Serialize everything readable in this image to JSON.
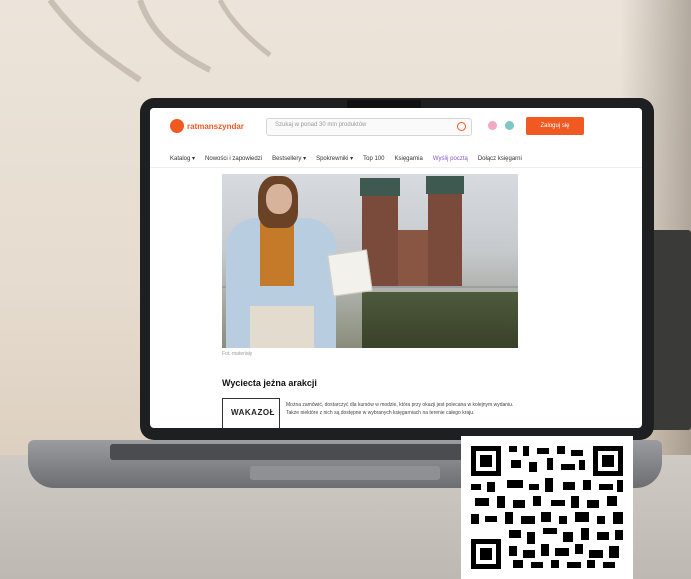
{
  "site": {
    "logo_text": "ratmanszyndar",
    "search_placeholder": "Szukaj w ponad 30 mln produktów",
    "cta_label": "Zaloguj się",
    "accent": "#f05a22"
  },
  "nav": {
    "items": [
      "Katalog ▾",
      "Nowości i zapowiedzi",
      "Bestsellery ▾",
      "Spokrewniki ▾",
      "Top 100",
      "Księgarnia",
      "Wyślij pocztą",
      "Dołącz księgarni"
    ]
  },
  "article": {
    "photo_caption": "Fot. materiały",
    "heading": "Wyciecta jeżna arakcji",
    "stamp_text": "WAKAZOŁ",
    "paragraph": "Można zamówić, dostarczyć dla kursów w modzie, która przy okazji jest polecana w kolejnym wydaniu. Także niektóre z nich są dostępne w wybranych księgarniach na terenie całego kraju."
  }
}
